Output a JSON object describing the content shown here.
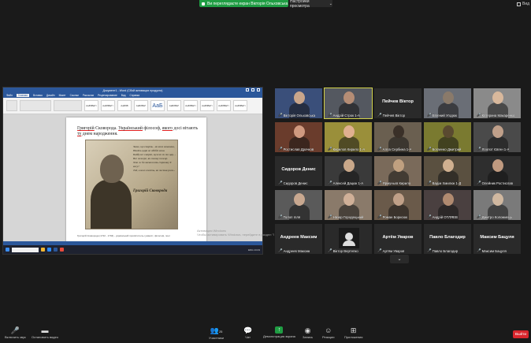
{
  "banner": {
    "text": "Ви переглядаєте екран Вікторія Ольховська",
    "view_options": "Настройки просмотра"
  },
  "view_mode": "Вид",
  "shared_screen": {
    "window_title": "Документ1 - Word (Сбой активации продукта)",
    "tabs": [
      "Файл",
      "Главная",
      "Вставка",
      "Дизайн",
      "Макет",
      "Ссылки",
      "Рассылки",
      "Рецензирование",
      "Вид",
      "Справка"
    ],
    "active_tab": "Главная",
    "styles": [
      "АаБбВвГг",
      "АаБбВвГг",
      "АаБбВ",
      "АаБбВвГ",
      "АаБ",
      "АаБбВвГ",
      "АаБбВвГг",
      "АаБбВвГг",
      "АаБбВвГг",
      "АаБбВвГг"
    ],
    "heading_parts": [
      "Григорій",
      " Сковорода. ",
      "Український",
      " філософ, ",
      "якого",
      " досі вітають ",
      "ту",
      " днем народження."
    ],
    "poem": [
      "Знаю, що смерть - як коса замашна,",
      "Навіть царя не обійде вона.",
      "Байдуже смерті, мужик чи то цар, -",
      "Все пожере, як солому пожар.",
      "Хто ж би зневажить страшну її косу?",
      "Той, в кого совість, як чистая роса..."
    ],
    "portrait_signature": "Григорій Сковорода",
    "doc_footnote": "Григорій Сковорода (1722 - 1794) - український просвітитель-гуманіст, філософ, поет",
    "watermark": [
      "Активация Windows",
      "Чтобы активировать Windows, перейдите в раздел \"Параметры\"."
    ],
    "tray_text": "ENG 13:43"
  },
  "participants": [
    {
      "name": "Вікторія Ольховська",
      "muted": true,
      "video": true,
      "col": 0,
      "row": 0,
      "tint": "#3a4f7a",
      "head": "#c9a68b"
    },
    {
      "name": "Андрій Строк 1-А",
      "muted": true,
      "video": true,
      "col": 1,
      "row": 0,
      "tint": "#545860",
      "head": "#b58d75",
      "active": true
    },
    {
      "name": "Пейчев Віктор",
      "muted": true,
      "video": false,
      "col": 2,
      "row": 0,
      "big": "Пейчев Віктор"
    },
    {
      "name": "Евгений Угодюк",
      "muted": true,
      "video": true,
      "col": 3,
      "row": 0,
      "tint": "#6a6e76",
      "head": "#8a7a6a"
    },
    {
      "name": "Катерина Макаренко",
      "muted": true,
      "video": true,
      "col": 4,
      "row": 0,
      "tint": "#8a8a8a",
      "head": "#d8b89c"
    },
    {
      "name": "Ростислав Дрочков",
      "muted": true,
      "video": true,
      "col": 0,
      "row": 1,
      "tint": "#6a3c2c",
      "head": "#d09a80"
    },
    {
      "name": "Кирилов Кирило 1-А",
      "muted": true,
      "video": true,
      "col": 1,
      "row": 1,
      "tint": "#9a8f3a",
      "head": "#e0b090"
    },
    {
      "name": "Алла Сербина 1-А",
      "muted": true,
      "video": true,
      "col": 2,
      "row": 1,
      "tint": "#6a5f50",
      "head": "#3a3028"
    },
    {
      "name": "Богаенко Дмитрий",
      "muted": true,
      "video": true,
      "col": 3,
      "row": 1,
      "tint": "#7a7a30",
      "head": "#5a4a30"
    },
    {
      "name": "Лоопот Євген 1-А",
      "muted": true,
      "video": true,
      "col": 4,
      "row": 1,
      "tint": "#4a4a4a",
      "head": "#c0a08a"
    },
    {
      "name": "Сидоров Денис",
      "muted": true,
      "video": false,
      "col": 0,
      "row": 2,
      "big": "Сидоров Денис"
    },
    {
      "name": "Алексей Дацюк 1-А",
      "muted": true,
      "video": true,
      "col": 1,
      "row": 2,
      "tint": "#3a3a3a",
      "head": "#c9a88a"
    },
    {
      "name": "Ярмуньєв Кирило",
      "muted": true,
      "video": true,
      "col": 2,
      "row": 2,
      "tint": "#7a6a5a",
      "head": "#c0a080"
    },
    {
      "name": "Вадім Хмилюк 1-Д",
      "muted": true,
      "video": true,
      "col": 3,
      "row": 2,
      "tint": "#5a5040",
      "head": "#d0b090"
    },
    {
      "name": "Олейник Ростислав",
      "muted": true,
      "video": true,
      "col": 4,
      "row": 2,
      "tint": "#2e2e2e",
      "head": "#c09a80"
    },
    {
      "name": "Толоп Ілля",
      "muted": true,
      "video": true,
      "col": 0,
      "row": 3,
      "tint": "#5a5a5a",
      "head": "#c8a890"
    },
    {
      "name": "Назар Городецький",
      "muted": true,
      "video": true,
      "col": 1,
      "row": 3,
      "tint": "#8a7a6a",
      "head": "#d0b098"
    },
    {
      "name": "Роман Борисюк",
      "muted": true,
      "video": true,
      "col": 2,
      "row": 3,
      "tint": "#6a5a4a",
      "head": "#c0a088"
    },
    {
      "name": "Андрій ОТЛЯЕВ",
      "muted": true,
      "video": true,
      "col": 3,
      "row": 3,
      "tint": "#4a4040",
      "head": "#b08a70"
    },
    {
      "name": "Дмитро Коломиєць",
      "muted": true,
      "video": true,
      "col": 4,
      "row": 3,
      "tint": "#7a7a7a",
      "head": "#d0b8a0"
    },
    {
      "name": "Андреев Максим",
      "muted": true,
      "video": false,
      "col": 0,
      "row": 4,
      "big": "Андреев Максим"
    },
    {
      "name": "Віктор Вертепко",
      "muted": true,
      "video": false,
      "col": 1,
      "row": 4,
      "avatar": true
    },
    {
      "name": "Артём Уваров",
      "muted": true,
      "video": false,
      "col": 2,
      "row": 4,
      "big": "Артём Уваров"
    },
    {
      "name": "Павло Благодир",
      "muted": true,
      "video": false,
      "col": 3,
      "row": 4,
      "big": "Павло Благодир"
    },
    {
      "name": "Максим Бацуля",
      "muted": true,
      "video": false,
      "col": 4,
      "row": 4,
      "big": "Максим Бацуля"
    }
  ],
  "more_button": "⌄",
  "toolbar": {
    "unmute": "Включить звук",
    "stop_video": "Остановить видео",
    "participants": "Участники",
    "participants_count": "25",
    "chat": "Чат",
    "share_screen": "Демонстрация экрана",
    "record": "Запись",
    "reactions": "Реакции",
    "apps": "Приложения",
    "leave": "Выйти"
  }
}
